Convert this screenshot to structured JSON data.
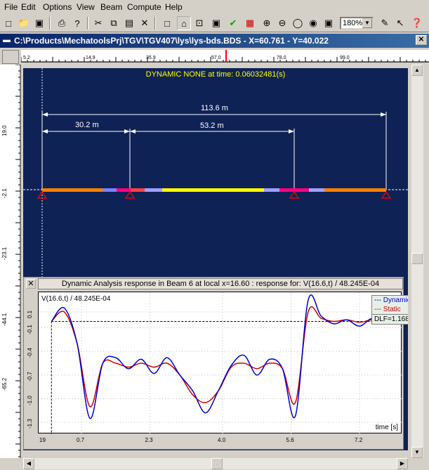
{
  "menu": [
    "File",
    "Edit",
    "Options",
    "View",
    "Beam",
    "Compute",
    "Help"
  ],
  "zoom": "180%",
  "title": "C:\\Products\\MechatoolsPrj\\TGV\\TGV407\\lys\\lys-bds.BDS - X=60.761 - Y=40.022",
  "hruler_ticks": [
    "5.2",
    "14.9",
    "35.9",
    "57.0",
    "78.0",
    "99.0"
  ],
  "vruler_ticks": [
    "19.0",
    "-2.1",
    "-23.1",
    "-44.1",
    "-65.2"
  ],
  "canvas": {
    "header": "DYNAMIC  NONE at time: 0.06032481(s)",
    "dim_total": "113.6 m",
    "dim_left": "30.2 m",
    "dim_mid": "53.2 m"
  },
  "plot": {
    "title": "Dynamic Analysis response in Beam 6 at local x=16.60 : response for:  V(16.6,t) / 48.245E-04",
    "ylabel": "V(16.6,t) / 48.245E-04",
    "legend": [
      "--- Dynamic",
      "--- Static",
      "DLF=1.168"
    ],
    "xlabel": "time [s]",
    "x_ticks": [
      "19",
      "0.7",
      "2.3",
      "4.0",
      "5.6",
      "7.2"
    ],
    "y_ticks": [
      "0.1",
      "-0.1",
      "-0.4",
      "-0.7",
      "-1.0",
      "-1.3"
    ]
  },
  "chart_data": {
    "type": "line",
    "xlabel": "time [s]",
    "ylabel": "V(16.6,t) / 48.245E-04",
    "x": [
      0.0,
      0.3,
      0.6,
      0.9,
      1.2,
      1.5,
      1.8,
      2.1,
      2.4,
      2.7,
      3.0,
      3.3,
      3.6,
      3.9,
      4.2,
      4.5,
      4.8,
      5.1,
      5.4,
      5.7,
      6.0,
      6.3,
      6.6,
      6.9,
      7.2,
      7.5,
      7.8
    ],
    "series": [
      {
        "name": "Dynamic",
        "color": "#0000cc",
        "values": [
          -0.02,
          0.15,
          -0.3,
          -1.25,
          -0.55,
          -0.48,
          -0.62,
          -0.5,
          -0.68,
          -0.48,
          -0.7,
          -0.9,
          -1.18,
          -0.9,
          -0.58,
          -0.45,
          -0.7,
          -0.5,
          -0.62,
          -1.22,
          0.25,
          0.05,
          -0.05,
          0.0,
          -0.08,
          0.02,
          -0.05
        ]
      },
      {
        "name": "Static",
        "color": "#cc0000",
        "values": [
          -0.02,
          0.1,
          -0.3,
          -1.1,
          -0.55,
          -0.55,
          -0.6,
          -0.55,
          -0.6,
          -0.55,
          -0.7,
          -0.95,
          -1.05,
          -0.9,
          -0.6,
          -0.55,
          -0.62,
          -0.55,
          -0.62,
          -1.05,
          0.1,
          0.02,
          -0.02,
          0.0,
          -0.03,
          0.0,
          -0.02
        ]
      }
    ]
  }
}
